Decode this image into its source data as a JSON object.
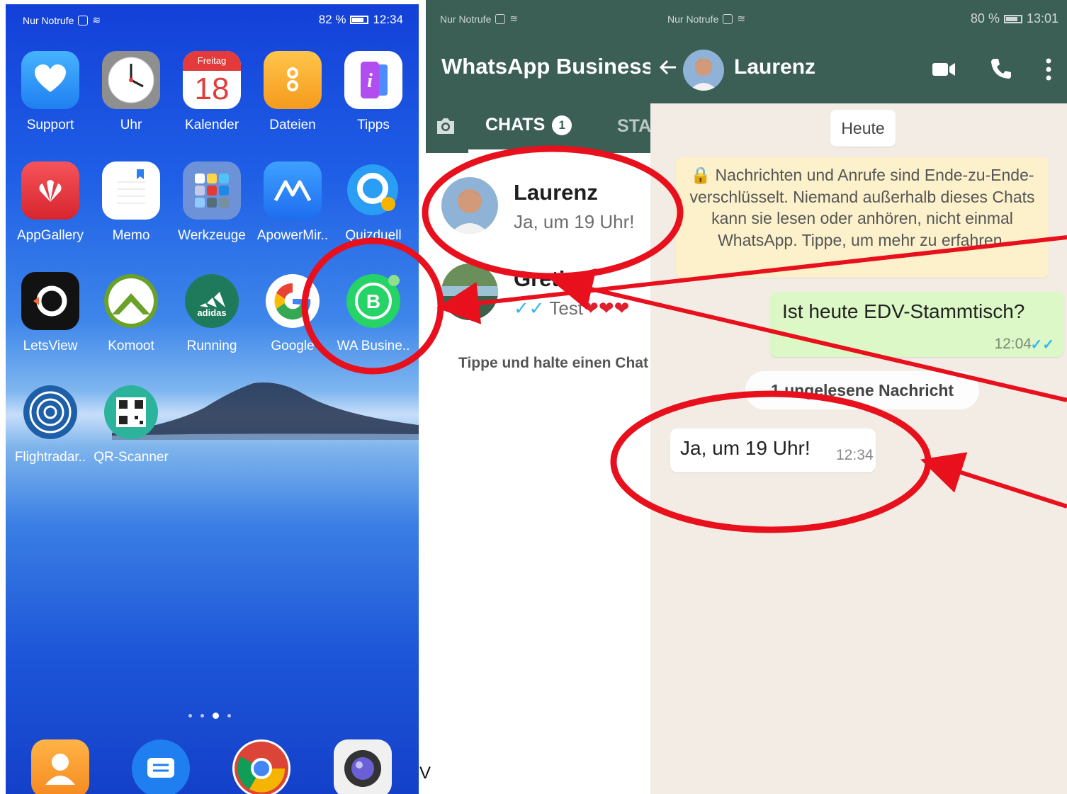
{
  "home": {
    "status_left": "Nur Notrufe",
    "status_battery": "82 %",
    "status_time": "12:34",
    "apps": [
      {
        "label": "Support",
        "icon": "heart-hand-icon"
      },
      {
        "label": "Uhr",
        "icon": "clock-icon"
      },
      {
        "label": "Kalender",
        "icon": "calendar-icon",
        "day_name": "Freitag",
        "day_number": "18"
      },
      {
        "label": "Dateien",
        "icon": "folder-icon"
      },
      {
        "label": "Tipps",
        "icon": "tips-icon"
      },
      {
        "label": "AppGallery",
        "icon": "huawei-icon"
      },
      {
        "label": "Memo",
        "icon": "notepad-icon"
      },
      {
        "label": "Werkzeuge",
        "icon": "tools-folder-icon"
      },
      {
        "label": "ApowerMir..",
        "icon": "apowermirror-icon"
      },
      {
        "label": "Quizduell",
        "icon": "quiz-icon"
      },
      {
        "label": "LetsView",
        "icon": "letsview-icon"
      },
      {
        "label": "Komoot",
        "icon": "komoot-icon"
      },
      {
        "label": "Running",
        "icon": "adidas-icon",
        "icon_text": "adidas"
      },
      {
        "label": "Google",
        "icon": "google-icon"
      },
      {
        "label": "WA Busine..",
        "icon": "whatsapp-business-icon"
      },
      {
        "label": "Flightradar..",
        "icon": "radar-icon"
      },
      {
        "label": "QR-Scanner",
        "icon": "qr-code-icon"
      }
    ],
    "dock": [
      "contacts-icon",
      "messages-icon",
      "chrome-icon",
      "camera-icon"
    ]
  },
  "chatlist": {
    "status_left": "Nur Notrufe",
    "title": "WhatsApp Business",
    "tab_chats": "CHATS",
    "tab_chats_badge": "1",
    "tab_status_partial": "STA",
    "chats": [
      {
        "name": "Laurenz",
        "last_message": "Ja, um 19 Uhr!"
      },
      {
        "name": "Greti",
        "last_message": "Test",
        "ticks": "✓✓",
        "hearts": "❤❤❤"
      }
    ],
    "hint": "Tippe und halte einen Chat",
    "stray_char": "V"
  },
  "conversation": {
    "status_left": "Nur Notrufe",
    "status_battery": "80 %",
    "status_time": "13:01",
    "contact_name": "Laurenz",
    "day_chip": "Heute",
    "encryption_note": "Nachrichten und Anrufe sind Ende-zu-Ende-verschlüsselt. Niemand außerhalb dieses Chats kann sie lesen oder anhören, nicht einmal WhatsApp. Tippe, um mehr zu erfahren.",
    "messages": [
      {
        "direction": "out",
        "text": "Ist heute EDV-Stammtisch?",
        "time": "12:04",
        "ticks": "✓✓"
      },
      {
        "direction": "in",
        "text": "Ja, um 19 Uhr!",
        "time": "12:34"
      }
    ],
    "unread_divider": "1 ungelesene Nachricht"
  },
  "colors": {
    "whatsapp_header": "#3b5e55",
    "annotation_red": "#e8101c",
    "outgoing_bubble": "#dcf8c6",
    "chat_background": "#f3ece4"
  }
}
